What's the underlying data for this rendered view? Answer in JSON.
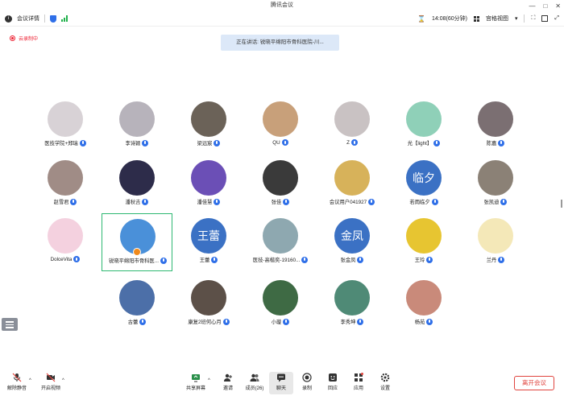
{
  "window": {
    "title": "腾讯会议"
  },
  "toolbar": {
    "meeting_info": "会议详情",
    "timer": "14:08(60分钟)",
    "view_mode": "宫格视图"
  },
  "recording": {
    "label": "云录制中"
  },
  "speaking": {
    "label": "正在讲话: 锐晓平绵阳市骨科医院-川..."
  },
  "participants": [
    {
      "name": "医技学院+郑瑞",
      "avatar_color": "#d8d2d6",
      "initial": ""
    },
    {
      "name": "李诗颖",
      "avatar_color": "#b7b3bb",
      "initial": ""
    },
    {
      "name": "梁远宸",
      "avatar_color": "#6b6258",
      "initial": ""
    },
    {
      "name": "QU",
      "avatar_color": "#c8a07a",
      "initial": ""
    },
    {
      "name": "Z",
      "avatar_color": "#c9c2c3",
      "initial": ""
    },
    {
      "name": "光【light】",
      "avatar_color": "#8fd0b8",
      "initial": ""
    },
    {
      "name": "陈嘉",
      "avatar_color": "#7b6f72",
      "initial": ""
    },
    {
      "name": "赵雪君",
      "avatar_color": "#a08c86",
      "initial": ""
    },
    {
      "name": "潘秋吉",
      "avatar_color": "#2d2c4a",
      "initial": ""
    },
    {
      "name": "潘佳慧",
      "avatar_color": "#6b4fb6",
      "initial": ""
    },
    {
      "name": "张佳",
      "avatar_color": "#3a3a3a",
      "initial": ""
    },
    {
      "name": "会议用户041927",
      "avatar_color": "#d7b25a",
      "initial": ""
    },
    {
      "name": "若雨临夕",
      "avatar_color": "#3b71c4",
      "initial": "临夕"
    },
    {
      "name": "张凯迪",
      "avatar_color": "#8b8176",
      "initial": ""
    },
    {
      "name": "DolceVita",
      "avatar_color": "#f4d1df",
      "initial": ""
    },
    {
      "name": "锐晓平绵阳市骨科医...",
      "avatar_color": "#4a90d9",
      "initial": ""
    },
    {
      "name": "王蕾",
      "avatar_color": "#3b71c4",
      "initial": "王蕾"
    },
    {
      "name": "医技-高楷奕-19160...",
      "avatar_color": "#8ea8b0",
      "initial": ""
    },
    {
      "name": "张金凤",
      "avatar_color": "#3b71c4",
      "initial": "金凤"
    },
    {
      "name": "王玲",
      "avatar_color": "#e7c531",
      "initial": ""
    },
    {
      "name": "兰丹",
      "avatar_color": "#f4e8b8",
      "initial": ""
    },
    {
      "name": "古蕾",
      "avatar_color": "#4c6fa8",
      "initial": ""
    },
    {
      "name": "康复2班何心月",
      "avatar_color": "#5c5048",
      "initial": ""
    },
    {
      "name": "小璇",
      "avatar_color": "#3e6a44",
      "initial": ""
    },
    {
      "name": "李秀坤",
      "avatar_color": "#4f8a76",
      "initial": ""
    },
    {
      "name": "杨苑",
      "avatar_color": "#c98a7a",
      "initial": ""
    }
  ],
  "bottombar": {
    "unmute": "解除静音",
    "video": "开启视频",
    "share": "共享屏幕",
    "invite": "邀请",
    "members": "成员(26)",
    "chat": "聊天",
    "record": "录制",
    "apps_room": "回应",
    "apps": "应用",
    "settings": "设置",
    "leave": "离开会议"
  }
}
